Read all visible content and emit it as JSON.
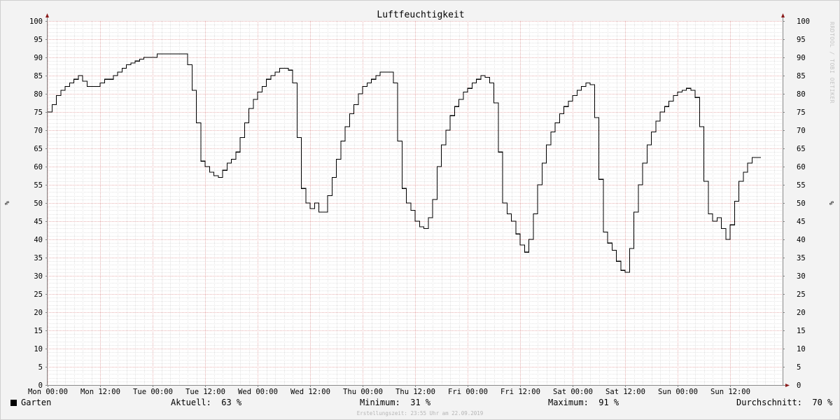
{
  "chart_data": {
    "type": "line",
    "title": "Luftfeuchtigkeit",
    "ylabel": "%",
    "ylim": [
      0,
      100
    ],
    "yticks": [
      0,
      5,
      10,
      15,
      20,
      25,
      30,
      35,
      40,
      45,
      50,
      55,
      60,
      65,
      70,
      75,
      80,
      85,
      90,
      95,
      100
    ],
    "xlim_hours": [
      0,
      168
    ],
    "xticks": [
      {
        "hour": 0,
        "label": "Mon 00:00"
      },
      {
        "hour": 12,
        "label": "Mon 12:00"
      },
      {
        "hour": 24,
        "label": "Tue 00:00"
      },
      {
        "hour": 36,
        "label": "Tue 12:00"
      },
      {
        "hour": 48,
        "label": "Wed 00:00"
      },
      {
        "hour": 60,
        "label": "Wed 12:00"
      },
      {
        "hour": 72,
        "label": "Thu 00:00"
      },
      {
        "hour": 84,
        "label": "Thu 12:00"
      },
      {
        "hour": 96,
        "label": "Fri 00:00"
      },
      {
        "hour": 108,
        "label": "Fri 12:00"
      },
      {
        "hour": 120,
        "label": "Sat 00:00"
      },
      {
        "hour": 132,
        "label": "Sat 12:00"
      },
      {
        "hour": 144,
        "label": "Sun 00:00"
      },
      {
        "hour": 156,
        "label": "Sun 12:00"
      }
    ],
    "grid": true,
    "series": [
      {
        "name": "Garten",
        "color": "#000000",
        "step": true,
        "points": [
          [
            0,
            75
          ],
          [
            1,
            77
          ],
          [
            2,
            79.5
          ],
          [
            3,
            81
          ],
          [
            4,
            82
          ],
          [
            5,
            83
          ],
          [
            6,
            84
          ],
          [
            7,
            85
          ],
          [
            8,
            83.5
          ],
          [
            9,
            82
          ],
          [
            10,
            82
          ],
          [
            11,
            82
          ],
          [
            12,
            83
          ],
          [
            13,
            84
          ],
          [
            14,
            84
          ],
          [
            15,
            85
          ],
          [
            16,
            86
          ],
          [
            17,
            87
          ],
          [
            18,
            88
          ],
          [
            19,
            88.5
          ],
          [
            20,
            89
          ],
          [
            21,
            89.5
          ],
          [
            22,
            90
          ],
          [
            23,
            90
          ],
          [
            24,
            90
          ],
          [
            25,
            91
          ],
          [
            26,
            91
          ],
          [
            27,
            91
          ],
          [
            28,
            91
          ],
          [
            29,
            91
          ],
          [
            30,
            91
          ],
          [
            31,
            91
          ],
          [
            32,
            88
          ],
          [
            33,
            81
          ],
          [
            34,
            72
          ],
          [
            35,
            61.5
          ],
          [
            36,
            60
          ],
          [
            37,
            58.5
          ],
          [
            38,
            57.5
          ],
          [
            39,
            57
          ],
          [
            40,
            59
          ],
          [
            41,
            61
          ],
          [
            42,
            62
          ],
          [
            43,
            64
          ],
          [
            44,
            68
          ],
          [
            45,
            72
          ],
          [
            46,
            76
          ],
          [
            47,
            78.5
          ],
          [
            48,
            80.5
          ],
          [
            49,
            82
          ],
          [
            50,
            84
          ],
          [
            51,
            85
          ],
          [
            52,
            86
          ],
          [
            53,
            87
          ],
          [
            54,
            87
          ],
          [
            55,
            86.5
          ],
          [
            56,
            83
          ],
          [
            57,
            68
          ],
          [
            58,
            54
          ],
          [
            59,
            50
          ],
          [
            60,
            48.5
          ],
          [
            61,
            50
          ],
          [
            62,
            47.5
          ],
          [
            63,
            47.5
          ],
          [
            64,
            52
          ],
          [
            65,
            57
          ],
          [
            66,
            62
          ],
          [
            67,
            67
          ],
          [
            68,
            71
          ],
          [
            69,
            74.5
          ],
          [
            70,
            77
          ],
          [
            71,
            80
          ],
          [
            72,
            82
          ],
          [
            73,
            83
          ],
          [
            74,
            84
          ],
          [
            75,
            85
          ],
          [
            76,
            86
          ],
          [
            77,
            86
          ],
          [
            78,
            86
          ],
          [
            79,
            83
          ],
          [
            80,
            67
          ],
          [
            81,
            54
          ],
          [
            82,
            50
          ],
          [
            83,
            48
          ],
          [
            84,
            45
          ],
          [
            85,
            43.5
          ],
          [
            86,
            43
          ],
          [
            87,
            46
          ],
          [
            88,
            51
          ],
          [
            89,
            60
          ],
          [
            90,
            66
          ],
          [
            91,
            70
          ],
          [
            92,
            74
          ],
          [
            93,
            76.5
          ],
          [
            94,
            78.5
          ],
          [
            95,
            80.5
          ],
          [
            96,
            81.5
          ],
          [
            97,
            83
          ],
          [
            98,
            84
          ],
          [
            99,
            85
          ],
          [
            100,
            84.5
          ],
          [
            101,
            83
          ],
          [
            102,
            77.5
          ],
          [
            103,
            64
          ],
          [
            104,
            50
          ],
          [
            105,
            47
          ],
          [
            106,
            45
          ],
          [
            107,
            41.5
          ],
          [
            108,
            38.5
          ],
          [
            109,
            36.5
          ],
          [
            110,
            40
          ],
          [
            111,
            47
          ],
          [
            112,
            55
          ],
          [
            113,
            61
          ],
          [
            114,
            66
          ],
          [
            115,
            69.5
          ],
          [
            116,
            72
          ],
          [
            117,
            74.5
          ],
          [
            118,
            76.5
          ],
          [
            119,
            78
          ],
          [
            120,
            79.5
          ],
          [
            121,
            81
          ],
          [
            122,
            82
          ],
          [
            123,
            83
          ],
          [
            124,
            82.5
          ],
          [
            125,
            73.5
          ],
          [
            126,
            56.5
          ],
          [
            127,
            42
          ],
          [
            128,
            39
          ],
          [
            129,
            37
          ],
          [
            130,
            34
          ],
          [
            131,
            31.5
          ],
          [
            132,
            31
          ],
          [
            133,
            37.5
          ],
          [
            134,
            47.5
          ],
          [
            135,
            55
          ],
          [
            136,
            61
          ],
          [
            137,
            66
          ],
          [
            138,
            69.5
          ],
          [
            139,
            72.5
          ],
          [
            140,
            75
          ],
          [
            141,
            76.5
          ],
          [
            142,
            78
          ],
          [
            143,
            79.5
          ],
          [
            144,
            80.5
          ],
          [
            145,
            81
          ],
          [
            146,
            81.5
          ],
          [
            147,
            81
          ],
          [
            148,
            79
          ],
          [
            149,
            71
          ],
          [
            150,
            56
          ],
          [
            151,
            47
          ],
          [
            152,
            45
          ],
          [
            153,
            46
          ],
          [
            154,
            43
          ],
          [
            155,
            40
          ],
          [
            156,
            44
          ],
          [
            157,
            50.5
          ],
          [
            158,
            56
          ],
          [
            159,
            58.5
          ],
          [
            160,
            61
          ],
          [
            161,
            62.5
          ],
          [
            162,
            62.5
          ]
        ]
      }
    ]
  },
  "legend": {
    "series_label": "Garten",
    "current_label": "Aktuell:",
    "current_value": "63 %",
    "min_label": "Minimum:",
    "min_value": "31 %",
    "max_label": "Maximum:",
    "max_value": "91 %",
    "avg_label": "Durchschnitt:",
    "avg_value": "70 %"
  },
  "footer": "Erstellungszeit: 23:55 Uhr am 22.09.2019",
  "watermark": "RRDTOOL / TOBI OETIKER"
}
